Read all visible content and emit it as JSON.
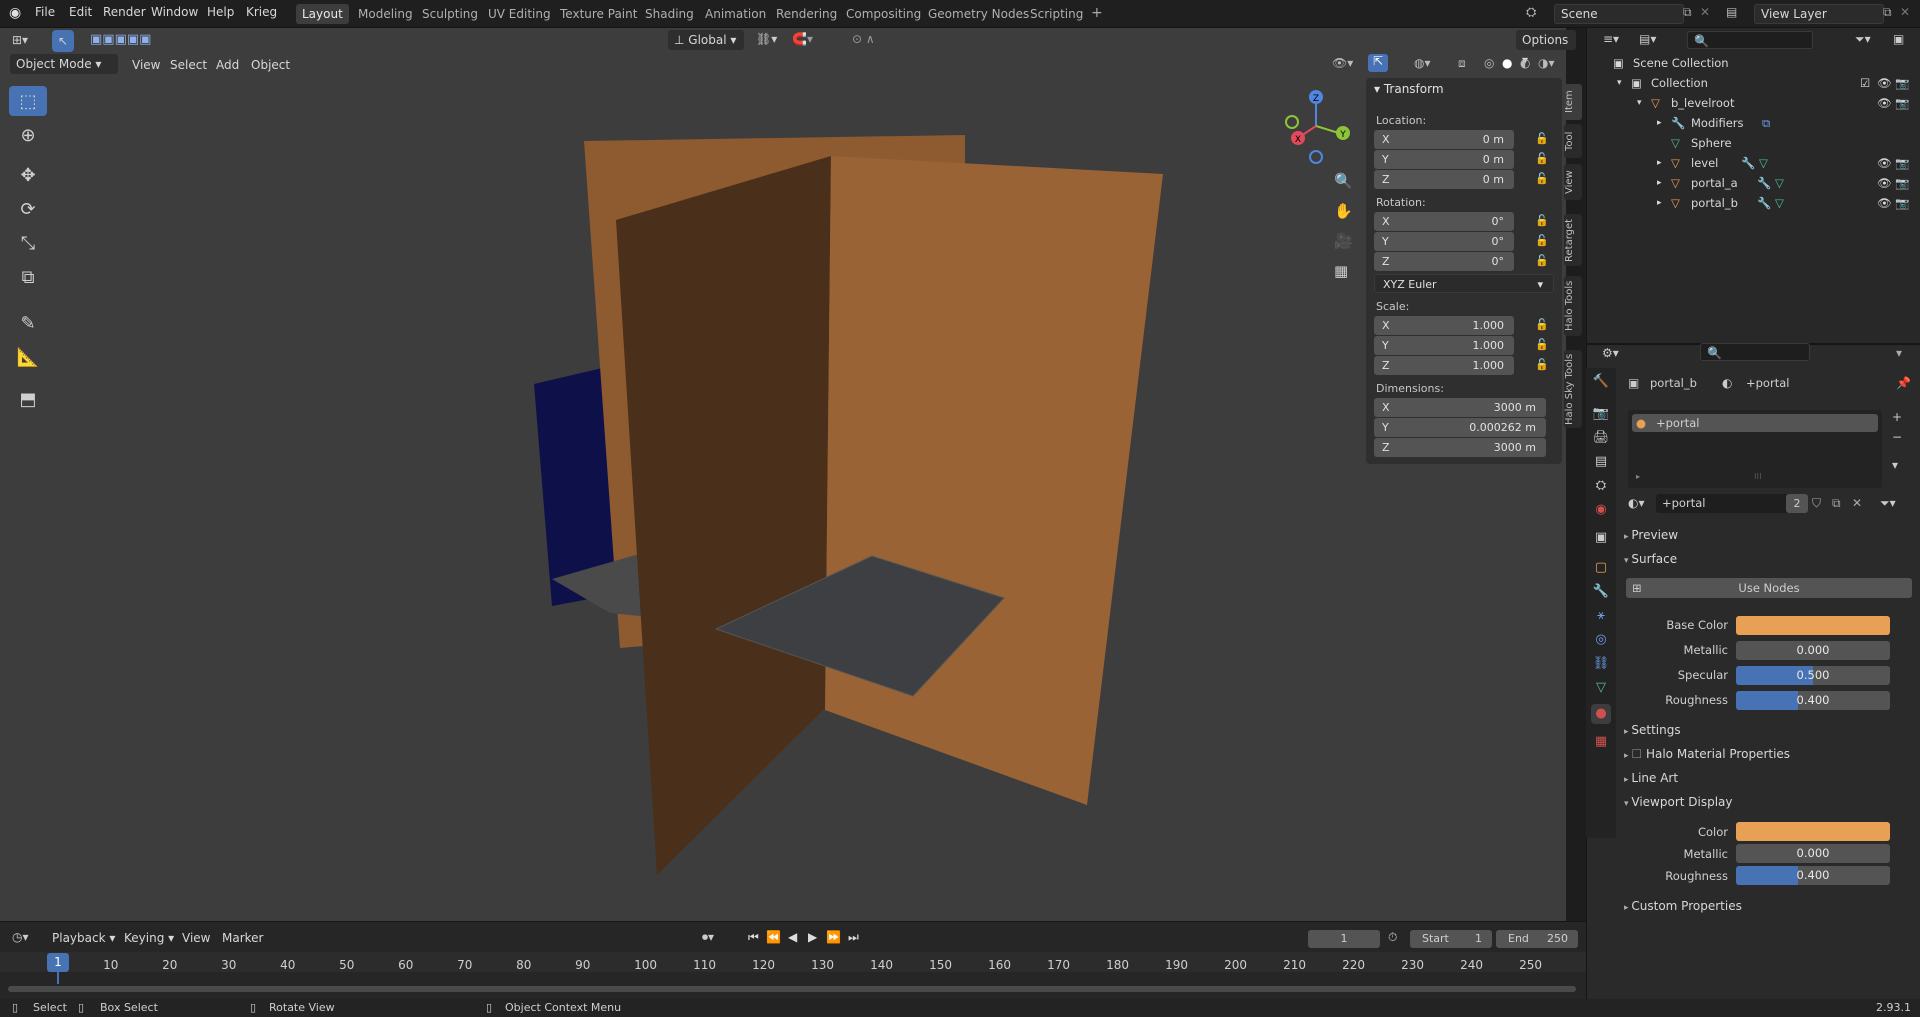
{
  "app": {
    "accent": "#4772b3",
    "object_color": "#e8a055",
    "version": "2.93.1"
  },
  "menu": [
    "File",
    "Edit",
    "Render",
    "Window",
    "Help",
    "Krieg"
  ],
  "workspaces": [
    "Layout",
    "Modeling",
    "Sculpting",
    "UV Editing",
    "Texture Paint",
    "Shading",
    "Animation",
    "Rendering",
    "Compositing",
    "Geometry Nodes",
    "Scripting"
  ],
  "active_workspace": "Layout",
  "scene": {
    "name": "Scene",
    "view_layer": "View Layer"
  },
  "viewport_header": {
    "mode": "Object Mode",
    "view": "View",
    "select": "Select",
    "add": "Add",
    "object": "Object",
    "orientation": "Global",
    "options": "Options"
  },
  "tools": [
    "select-box-icon",
    "cursor-icon",
    "move-icon",
    "rotate-icon",
    "scale-icon",
    "transform-icon",
    "annotate-icon",
    "measure-icon",
    "add-cube-icon"
  ],
  "gizmo": {
    "x": "X",
    "y": "Y",
    "z": "Z"
  },
  "npanel": {
    "title": "Transform",
    "location_label": "Location:",
    "location": [
      {
        "axis": "X",
        "value": "0 m"
      },
      {
        "axis": "Y",
        "value": "0 m"
      },
      {
        "axis": "Z",
        "value": "0 m"
      }
    ],
    "rotation_label": "Rotation:",
    "rotation": [
      {
        "axis": "X",
        "value": "0°"
      },
      {
        "axis": "Y",
        "value": "0°"
      },
      {
        "axis": "Z",
        "value": "0°"
      }
    ],
    "rotation_mode": "XYZ Euler",
    "scale_label": "Scale:",
    "scale": [
      {
        "axis": "X",
        "value": "1.000"
      },
      {
        "axis": "Y",
        "value": "1.000"
      },
      {
        "axis": "Z",
        "value": "1.000"
      }
    ],
    "dimensions_label": "Dimensions:",
    "dimensions": [
      {
        "axis": "X",
        "value": "3000 m"
      },
      {
        "axis": "Y",
        "value": "0.000262 m"
      },
      {
        "axis": "Z",
        "value": "3000 m"
      }
    ],
    "tabs": [
      "Item",
      "Tool",
      "View",
      "Retarget",
      "Halo Tools",
      "Halo Sky Tools"
    ]
  },
  "outliner": {
    "root": "Scene Collection",
    "rows": [
      {
        "label": "Collection"
      },
      {
        "label": "b_levelroot"
      },
      {
        "label": "Modifiers"
      },
      {
        "label": "Sphere"
      },
      {
        "label": "level"
      },
      {
        "label": "portal_a"
      },
      {
        "label": "portal_b"
      }
    ]
  },
  "properties": {
    "breadcrumb_object": "portal_b",
    "breadcrumb_material": "+portal",
    "slot": "+portal",
    "material_name": "+portal",
    "user_count": "2",
    "sections": {
      "preview": "Preview",
      "surface": "Surface",
      "settings": "Settings",
      "halo": "Halo Material Properties",
      "line_art": "Line Art",
      "viewport_display": "Viewport Display",
      "custom": "Custom Properties"
    },
    "use_nodes": "Use Nodes",
    "surface_fields": [
      {
        "label": "Base Color",
        "type": "color",
        "value": ""
      },
      {
        "label": "Metallic",
        "type": "slider",
        "value": "0.000",
        "fraction": 0
      },
      {
        "label": "Specular",
        "type": "slider",
        "value": "0.500",
        "fraction": 0.5
      },
      {
        "label": "Roughness",
        "type": "slider",
        "value": "0.400",
        "fraction": 0.4
      }
    ],
    "vd_fields": [
      {
        "label": "Color",
        "type": "color",
        "value": ""
      },
      {
        "label": "Metallic",
        "type": "slider",
        "value": "0.000",
        "fraction": 0
      },
      {
        "label": "Roughness",
        "type": "slider",
        "value": "0.400",
        "fraction": 0.4
      }
    ]
  },
  "timeline": {
    "playback": "Playback",
    "keying": "Keying",
    "view": "View",
    "marker": "Marker",
    "current_frame": "1",
    "start_label": "Start",
    "start": "1",
    "end_label": "End",
    "end": "250",
    "ticks": [
      "1",
      "10",
      "20",
      "30",
      "40",
      "50",
      "60",
      "70",
      "80",
      "90",
      "100",
      "110",
      "120",
      "130",
      "140",
      "150",
      "160",
      "170",
      "180",
      "190",
      "200",
      "210",
      "220",
      "230",
      "240",
      "250"
    ]
  },
  "status": {
    "select": "Select",
    "box_select": "Box Select",
    "rotate_view": "Rotate View",
    "context_menu": "Object Context Menu"
  }
}
